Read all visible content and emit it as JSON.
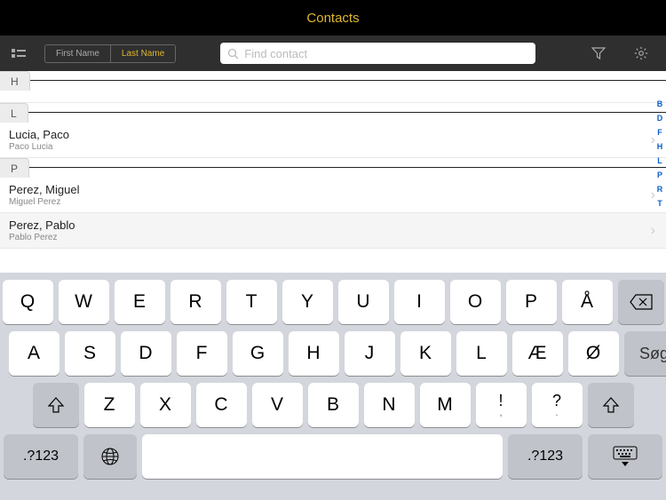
{
  "header": {
    "title": "Contacts"
  },
  "toolbar": {
    "sort": {
      "first": "First Name",
      "last": "Last Name",
      "active": "last"
    },
    "search": {
      "placeholder": "Find contact"
    }
  },
  "sections": [
    {
      "letter": "H",
      "rows": []
    },
    {
      "letter": "L",
      "rows": [
        {
          "name": "Lucia, Paco",
          "sub": "Paco Lucia"
        }
      ]
    },
    {
      "letter": "P",
      "rows": [
        {
          "name": "Perez, Miguel",
          "sub": "Miguel Perez"
        },
        {
          "name": "Perez, Pablo",
          "sub": "Pablo Perez",
          "highlight": true
        }
      ]
    }
  ],
  "index_letters": [
    "B",
    "D",
    "F",
    "H",
    "L",
    "P",
    "R",
    "T"
  ],
  "keyboard": {
    "row1": [
      "Q",
      "W",
      "E",
      "R",
      "T",
      "Y",
      "U",
      "I",
      "O",
      "P",
      "Å"
    ],
    "row2": [
      "A",
      "S",
      "D",
      "F",
      "G",
      "H",
      "J",
      "K",
      "L",
      "Æ",
      "Ø"
    ],
    "row3": [
      "Z",
      "X",
      "C",
      "V",
      "B",
      "N",
      "M",
      "!",
      ",",
      "?",
      "."
    ],
    "row3_display": [
      "Z",
      "X",
      "C",
      "V",
      "B",
      "N",
      "M",
      "!",
      "?"
    ],
    "row3_pairs": [
      {
        "main": "!",
        "sup": ","
      },
      {
        "main": "?",
        "sup": "."
      }
    ],
    "search_label": "Søg",
    "num_label": ".?123"
  }
}
